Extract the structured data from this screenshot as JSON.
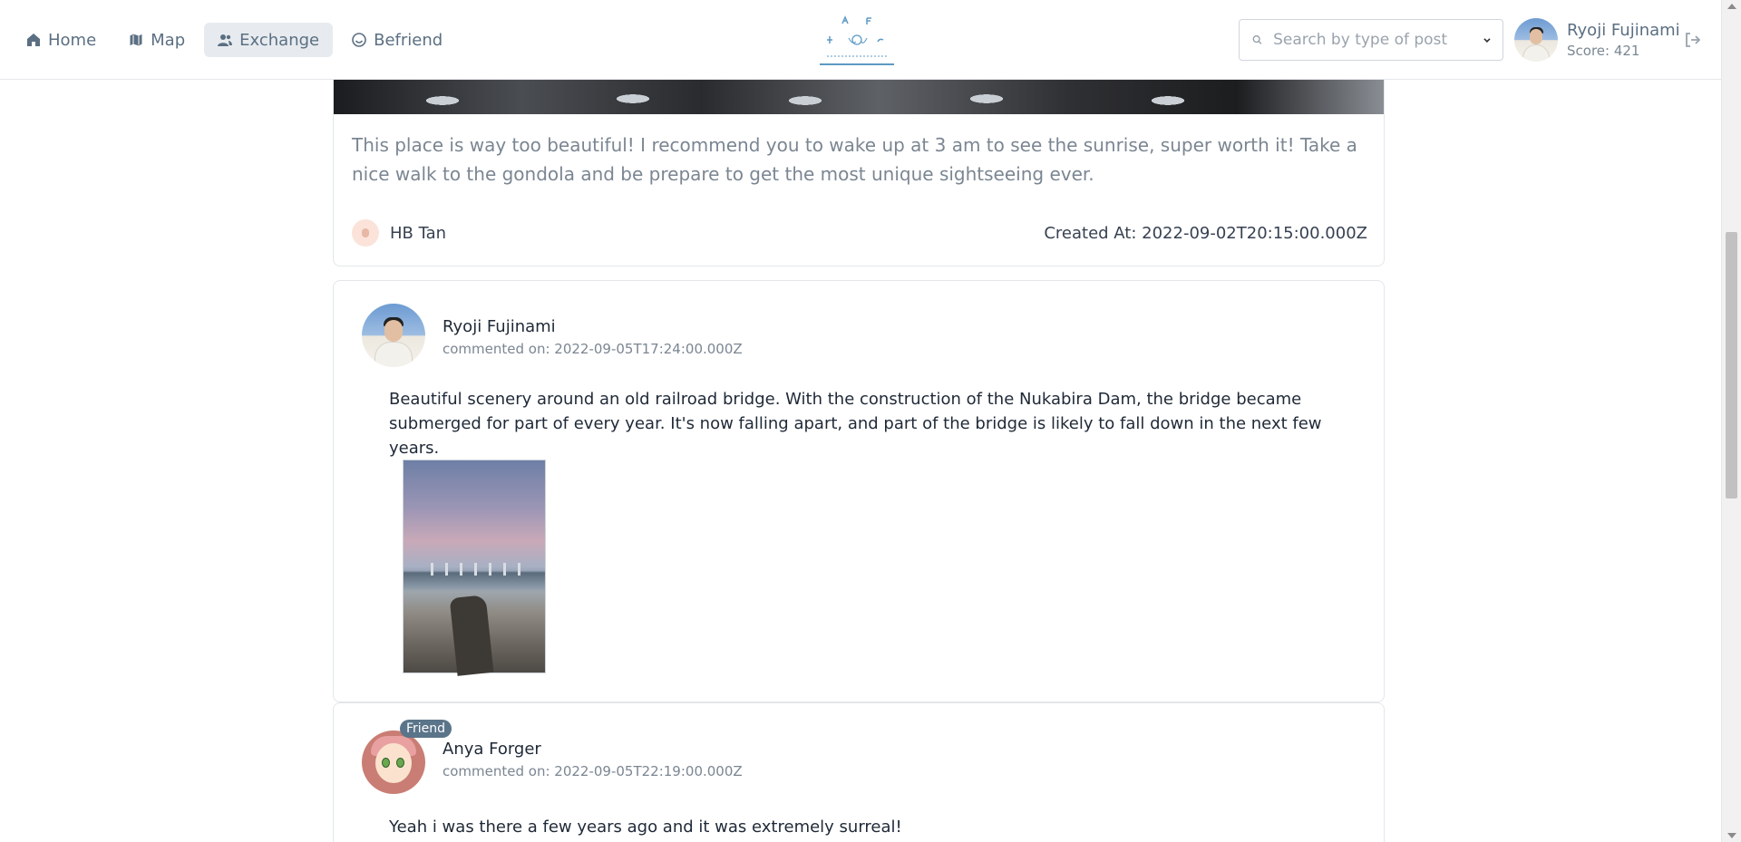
{
  "nav": {
    "items": [
      {
        "label": "Home",
        "icon": "home-icon",
        "active": false
      },
      {
        "label": "Map",
        "icon": "map-icon",
        "active": false
      },
      {
        "label": "Exchange",
        "icon": "users-icon",
        "active": true
      },
      {
        "label": "Befriend",
        "icon": "smile-icon",
        "active": false
      }
    ],
    "search_placeholder": "Search by type of post",
    "user": {
      "name": "Ryoji Fujinami",
      "score": "Score: 421"
    }
  },
  "post": {
    "text": "This place is way too beautiful! I recommend you to wake up at 3 am to see the sunrise, super worth it! Take a nice walk to the gondola and be prepare to get the most unique sightseeing ever.",
    "author": "HB Tan",
    "created": "Created At: 2022-09-02T20:15:00.000Z"
  },
  "comments": [
    {
      "name": "Ryoji Fujinami",
      "date": "commented on: 2022-09-05T17:24:00.000Z",
      "text": "Beautiful scenery around an old railroad bridge. With the construction of the Nukabira Dam, the bridge became submerged for part of every year. It's now falling apart, and part of the bridge is likely to fall down in the next few years.",
      "badge": ""
    },
    {
      "name": "Anya Forger",
      "date": "commented on: 2022-09-05T22:19:00.000Z",
      "text": "Yeah i was there a few years ago and it was extremely surreal!",
      "badge": "Friend"
    }
  ],
  "colors": {
    "accent": "#5b6f82",
    "badge": "#5a7489",
    "logo_line": "#5d9ac5"
  }
}
